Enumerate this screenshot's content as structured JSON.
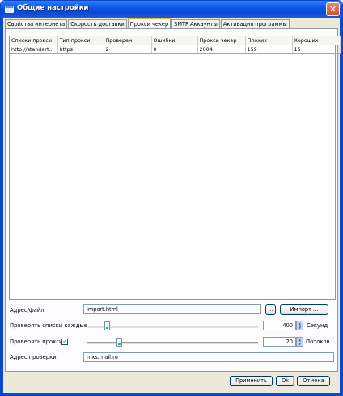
{
  "window": {
    "title": "Общие настройки"
  },
  "tabs": [
    {
      "label": "Свойства интернета"
    },
    {
      "label": "Скорость доставки"
    },
    {
      "label": "Прокси чекер"
    },
    {
      "label": "SMTP Аккаунты"
    },
    {
      "label": "Активация программы"
    }
  ],
  "table": {
    "columns": [
      "Списки прокси",
      "Тип прокси",
      "Проверен",
      "Ошибки",
      "Прокси чекер",
      "Плохих",
      "Хороших"
    ],
    "rows": [
      [
        "http://standart...",
        "https",
        "2",
        "0",
        "2004",
        "159",
        "15"
      ]
    ]
  },
  "form": {
    "address_label": "Адрес/файл",
    "address_value": "import.html",
    "browse_label": "...",
    "import_label": "Импорт ...",
    "check_lists_label": "Проверять списки каждые",
    "check_lists_value": "400",
    "check_lists_unit": "Секунд",
    "check_lists_slider_level": 0.12,
    "check_proxy_label": "Проверять прокси",
    "check_proxy_checked": true,
    "threads_value": "20",
    "threads_unit": "Потоков",
    "threads_slider_level": 0.19,
    "check_address_label": "Адрес проверки",
    "check_address_value": "mxs.mail.ru"
  },
  "buttons": {
    "apply": "Применить",
    "ok": "Ok",
    "cancel": "Отмена"
  },
  "colors": {
    "title_bar": "#0a54e3",
    "face": "#ece9d8",
    "close": "#d4502b",
    "accent_tab": "#f0b030"
  }
}
